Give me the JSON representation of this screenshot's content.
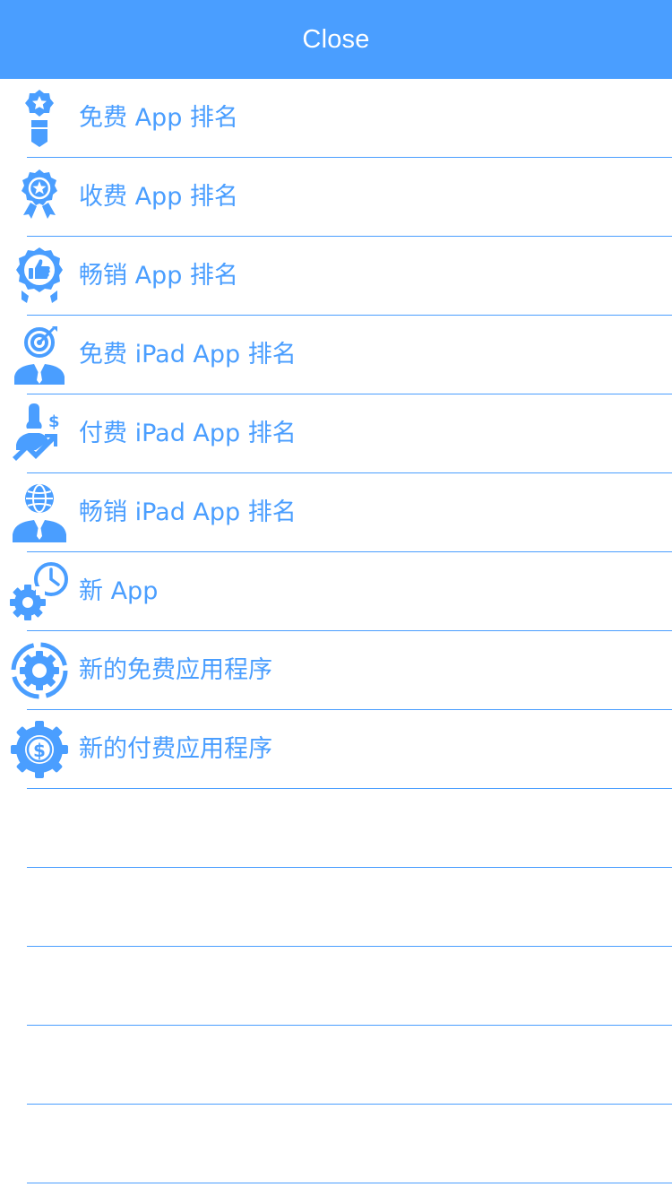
{
  "header": {
    "title": "Close"
  },
  "theme": {
    "accent": "#4a9eff",
    "background": "#ffffff"
  },
  "menu": [
    {
      "label": "免费 App 排名",
      "icon": "award-ribbon-icon"
    },
    {
      "label": "收费 App 排名",
      "icon": "star-rosette-icon"
    },
    {
      "label": "畅销 App 排名",
      "icon": "thumbs-up-badge-icon"
    },
    {
      "label": "免费 iPad App 排名",
      "icon": "target-businessman-icon"
    },
    {
      "label": "付费 iPad App 排名",
      "icon": "businesswoman-dollar-growth-icon"
    },
    {
      "label": "畅销 iPad App 排名",
      "icon": "globe-businessman-icon"
    },
    {
      "label": "新 App",
      "icon": "gear-clock-icon"
    },
    {
      "label": "新的免费应用程序",
      "icon": "gear-ring-icon"
    },
    {
      "label": "新的付费应用程序",
      "icon": "gear-dollar-icon"
    }
  ]
}
